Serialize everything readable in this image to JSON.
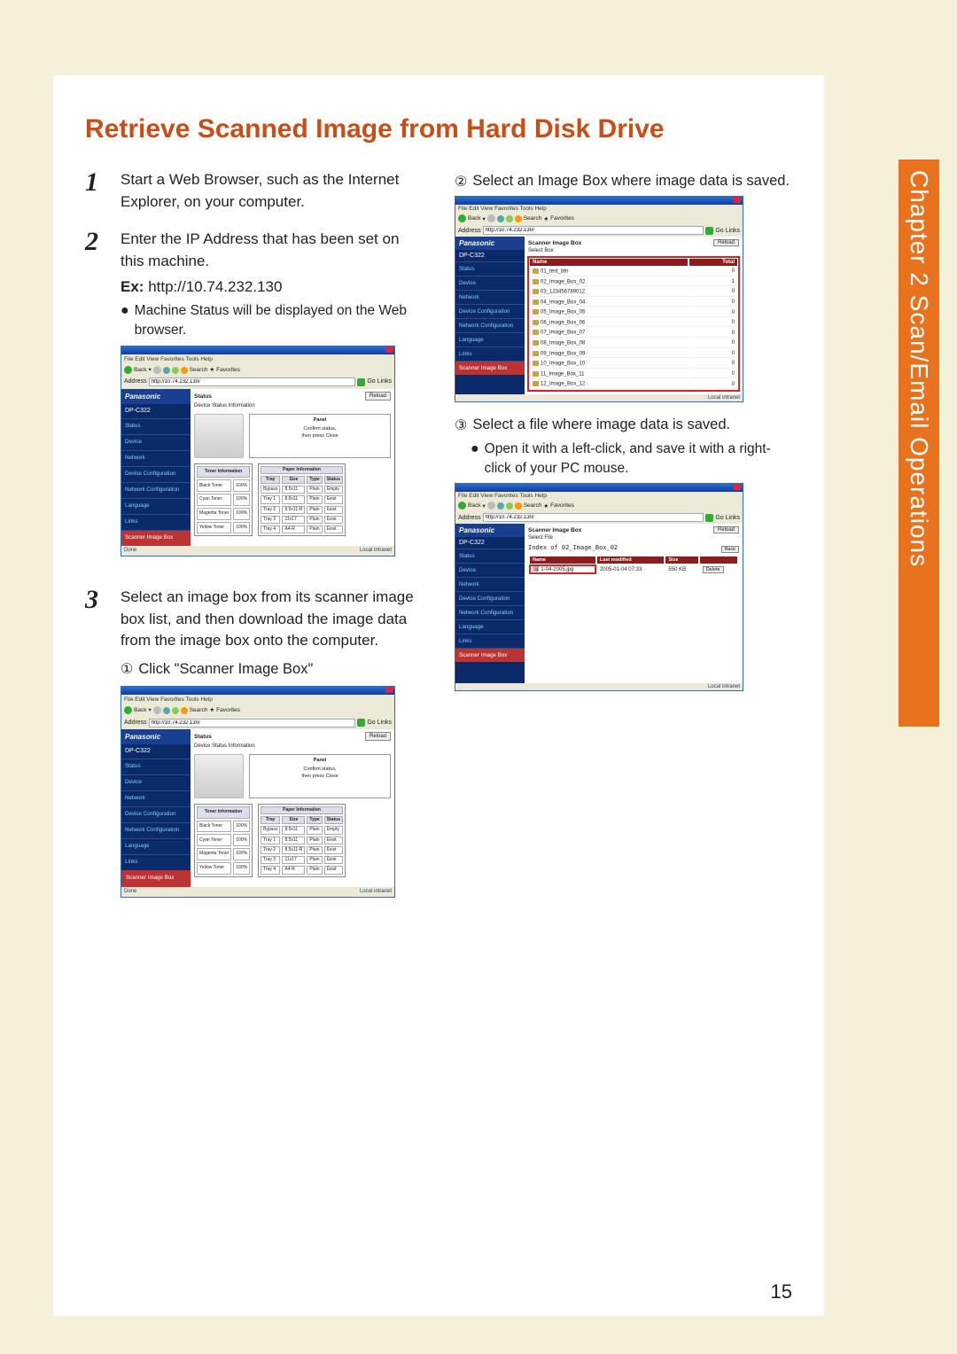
{
  "page": {
    "number": "15",
    "title": "Retrieve Scanned Image from Hard Disk Drive"
  },
  "side_tab": "Chapter 2  Scan/Email Operations",
  "steps": {
    "s1": {
      "num": "1",
      "text": "Start a Web Browser, such as the Internet Explorer, on your computer."
    },
    "s2": {
      "num": "2",
      "text": "Enter the IP Address that has been set on this machine.",
      "ex_label": "Ex:",
      "ex_value": "http://10.74.232.130",
      "bullet": "Machine Status will be displayed on the Web browser."
    },
    "s3": {
      "num": "3",
      "text": "Select an image box from its scanner image box list, and then download the image data from the image box onto the computer.",
      "sub1_mark": "①",
      "sub1_text": "Click \"Scanner Image Box\"",
      "sub2_mark": "②",
      "sub2_text": "Select an Image Box where image data is saved.",
      "sub3_mark": "③",
      "sub3_text": "Select a file where image data is saved.",
      "sub3_bullet": "Open it with a left-click, and save it with a right-click of your PC mouse."
    }
  },
  "browser": {
    "menu": "File   Edit   View   Favorites   Tools   Help",
    "back": "Back",
    "search": "Search",
    "favorites": "Favorites",
    "address_label": "Address",
    "address_value": "http://10.74.232.130/",
    "go": "Go",
    "links": "Links",
    "status_done": "Done",
    "status_zone": "Local intranet"
  },
  "panasonic": {
    "brand": "Panasonic",
    "model": "DP-C322",
    "nav": {
      "status": "Status",
      "device": "Device",
      "network": "Network",
      "device_conf": "Device Configuration",
      "network_conf": "Network Configuration",
      "language": "Language",
      "links": "Links",
      "scanner_box": "Scanner Image Box"
    },
    "reload": "Reload",
    "status_pane": {
      "title": "Status",
      "subtitle": "Device Status Information",
      "panel_label": "Panel",
      "panel_msg1": "Confirm status,",
      "panel_msg2": "then press Close"
    },
    "toner": {
      "caption": "Toner Information",
      "rows": [
        {
          "name": "Black Toner",
          "pct": "100%"
        },
        {
          "name": "Cyan Toner",
          "pct": "100%"
        },
        {
          "name": "Magenta Toner",
          "pct": "100%"
        },
        {
          "name": "Yellow Toner",
          "pct": "100%"
        }
      ]
    },
    "paper": {
      "caption": "Paper Information",
      "headers": {
        "tray": "Tray",
        "size": "Size",
        "type": "Type",
        "status": "Status"
      },
      "rows": [
        {
          "tray": "Bypass",
          "size": "8.5x11",
          "type": "Plain",
          "status": "Empty"
        },
        {
          "tray": "Tray 1",
          "size": "8.5x11",
          "type": "Plain",
          "status": "Exist"
        },
        {
          "tray": "Tray 2",
          "size": "8.5x11-R",
          "type": "Plain",
          "status": "Exist"
        },
        {
          "tray": "Tray 3",
          "size": "11x17",
          "type": "Plain",
          "status": "Exist"
        },
        {
          "tray": "Tray 4",
          "size": "A4-R",
          "type": "Plain",
          "status": "Exist"
        }
      ]
    }
  },
  "boxlist": {
    "title": "Scanner Image Box",
    "subtitle": "Select Box",
    "headers": {
      "name": "Name",
      "total": "Total"
    },
    "rows": [
      {
        "name": "01_test_btn",
        "total": "0"
      },
      {
        "name": "02_Image_Box_02",
        "total": "1"
      },
      {
        "name": "03_123456789012",
        "total": "0"
      },
      {
        "name": "04_Image_Box_04",
        "total": "0"
      },
      {
        "name": "05_Image_Box_05",
        "total": "0"
      },
      {
        "name": "06_Image_Box_06",
        "total": "0"
      },
      {
        "name": "07_Image_Box_07",
        "total": "0"
      },
      {
        "name": "08_Image_Box_08",
        "total": "0"
      },
      {
        "name": "09_Image_Box_09",
        "total": "0"
      },
      {
        "name": "10_Image_Box_10",
        "total": "0"
      },
      {
        "name": "11_Image_Box_11",
        "total": "0"
      },
      {
        "name": "12_Image_Box_12",
        "total": "0"
      }
    ]
  },
  "filelist": {
    "title": "Scanner Image Box",
    "subtitle": "Select File",
    "index_of": "Index of 02_Image_Box_02",
    "back": "Back",
    "headers": {
      "name": "Name",
      "modified": "Last modified",
      "size": "Size"
    },
    "row": {
      "name": "1-04-2005.jpg",
      "modified": "2005-01-04 07:33",
      "size": "550 KB"
    },
    "delete": "Delete"
  }
}
